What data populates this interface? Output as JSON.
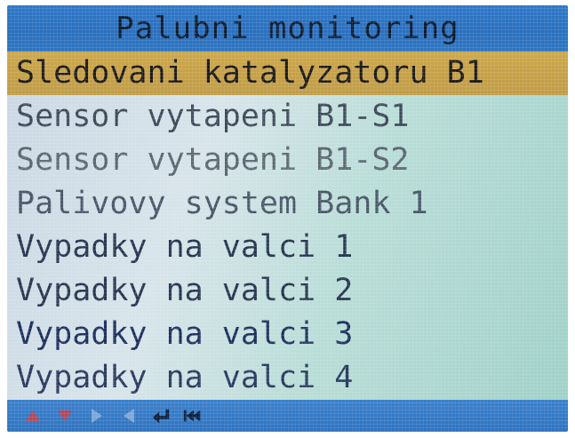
{
  "header": {
    "title": "Palubni monitoring"
  },
  "menu": {
    "items": [
      {
        "label": "Sledovani katalyzatoru B1",
        "selected": true
      },
      {
        "label": "Sensor vytapeni B1-S1",
        "selected": false
      },
      {
        "label": "Sensor vytapeni B1-S2",
        "selected": false
      },
      {
        "label": "Palivovy system Bank 1",
        "selected": false
      },
      {
        "label": "Vypadky na valci 1",
        "selected": false
      },
      {
        "label": "Vypadky na valci 2",
        "selected": false
      },
      {
        "label": "Vypadky na valci 3",
        "selected": false
      },
      {
        "label": "Vypadky na valci 4",
        "selected": false
      }
    ]
  },
  "status_bar": {
    "icons": [
      "up-arrow-icon",
      "down-arrow-icon",
      "right-arrow-icon",
      "left-arrow-icon",
      "enter-icon",
      "back-to-start-icon"
    ]
  },
  "colors": {
    "title_bar": "#2f78c8",
    "selection": "#c6a047",
    "status_bar": "#3b80cc",
    "arrow_red": "#b4485a",
    "arrow_faded": "#7fa6d6",
    "icon_dark": "#0d1f3a"
  }
}
